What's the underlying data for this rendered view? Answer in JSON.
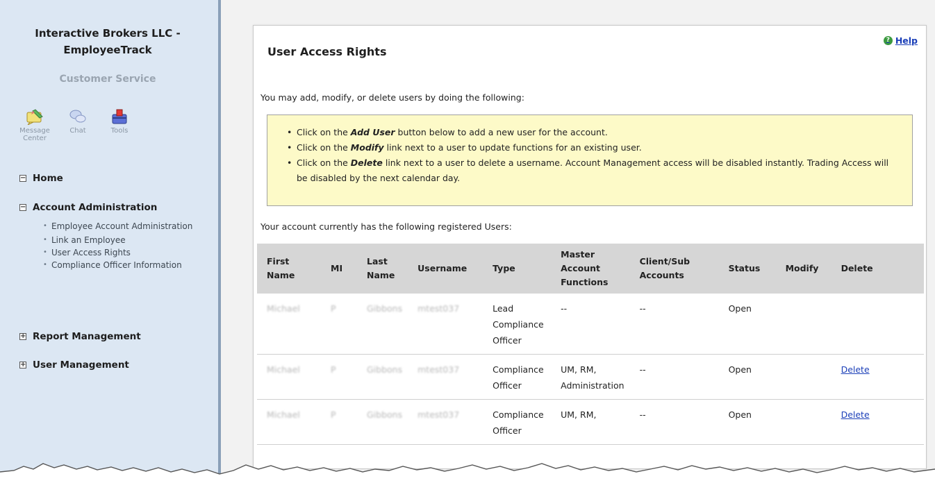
{
  "sidebar": {
    "brand_line1": "Interactive Brokers LLC -",
    "brand_line2": "EmployeeTrack",
    "section": "Customer Service",
    "tools": [
      {
        "icon": "message-center-icon",
        "label1": "Message",
        "label2": "Center"
      },
      {
        "icon": "chat-icon",
        "label1": "Chat",
        "label2": ""
      },
      {
        "icon": "tools-icon",
        "label1": "Tools",
        "label2": ""
      }
    ],
    "home": "Home",
    "account_admin": "Account Administration",
    "account_admin_items": [
      "Employee Account Administration",
      "Link an Employee",
      "User Access Rights",
      "Compliance Officer Information"
    ],
    "report_management": "Report Management",
    "user_management": "User Management"
  },
  "main": {
    "help": "Help",
    "title": "User Access Rights",
    "intro": "You may add, modify, or delete users by doing the following:",
    "notice": {
      "item1_pre": "Click on the ",
      "item1_em": "Add User",
      "item1_post": " button below to add a new user for the account.",
      "item2_pre": "Click on the ",
      "item2_em": "Modify",
      "item2_post": " link next to a user to update functions for an existing user.",
      "item3_pre": "Click on the ",
      "item3_em": "Delete",
      "item3_post": " link next to a user to delete a username. Account Management access will be disabled instantly. Trading Access will be disabled by the next calendar day."
    },
    "registered_text": "Your account currently has the following registered Users:",
    "table": {
      "headers": [
        "First Name",
        "MI",
        "Last Name",
        "Username",
        "Type",
        "Master Account Functions",
        "Client/Sub Accounts",
        "Status",
        "Modify",
        "Delete"
      ],
      "rows": [
        {
          "first": "Michael",
          "mi": "P",
          "last": "Gibbons",
          "username": "mtest037",
          "type": "Lead Compliance Officer",
          "functions": "--",
          "accounts": "--",
          "status": "Open",
          "modify": "",
          "delete": ""
        },
        {
          "first": "Michael",
          "mi": "P",
          "last": "Gibbons",
          "username": "mtest037",
          "type": "Compliance Officer",
          "functions": "UM, RM, Administration",
          "accounts": "--",
          "status": "Open",
          "modify": "",
          "delete": "Delete"
        },
        {
          "first": "Michael",
          "mi": "P",
          "last": "Gibbons",
          "username": "mtest037",
          "type": "Compliance Officer",
          "functions": "UM, RM,",
          "accounts": "--",
          "status": "Open",
          "modify": "",
          "delete": "Delete"
        }
      ]
    }
  },
  "colors": {
    "sidebar_bg": "#dce7f3",
    "notice_bg": "#fdfac8",
    "link": "#1b3fb8",
    "table_header_bg": "#d6d6d6"
  }
}
